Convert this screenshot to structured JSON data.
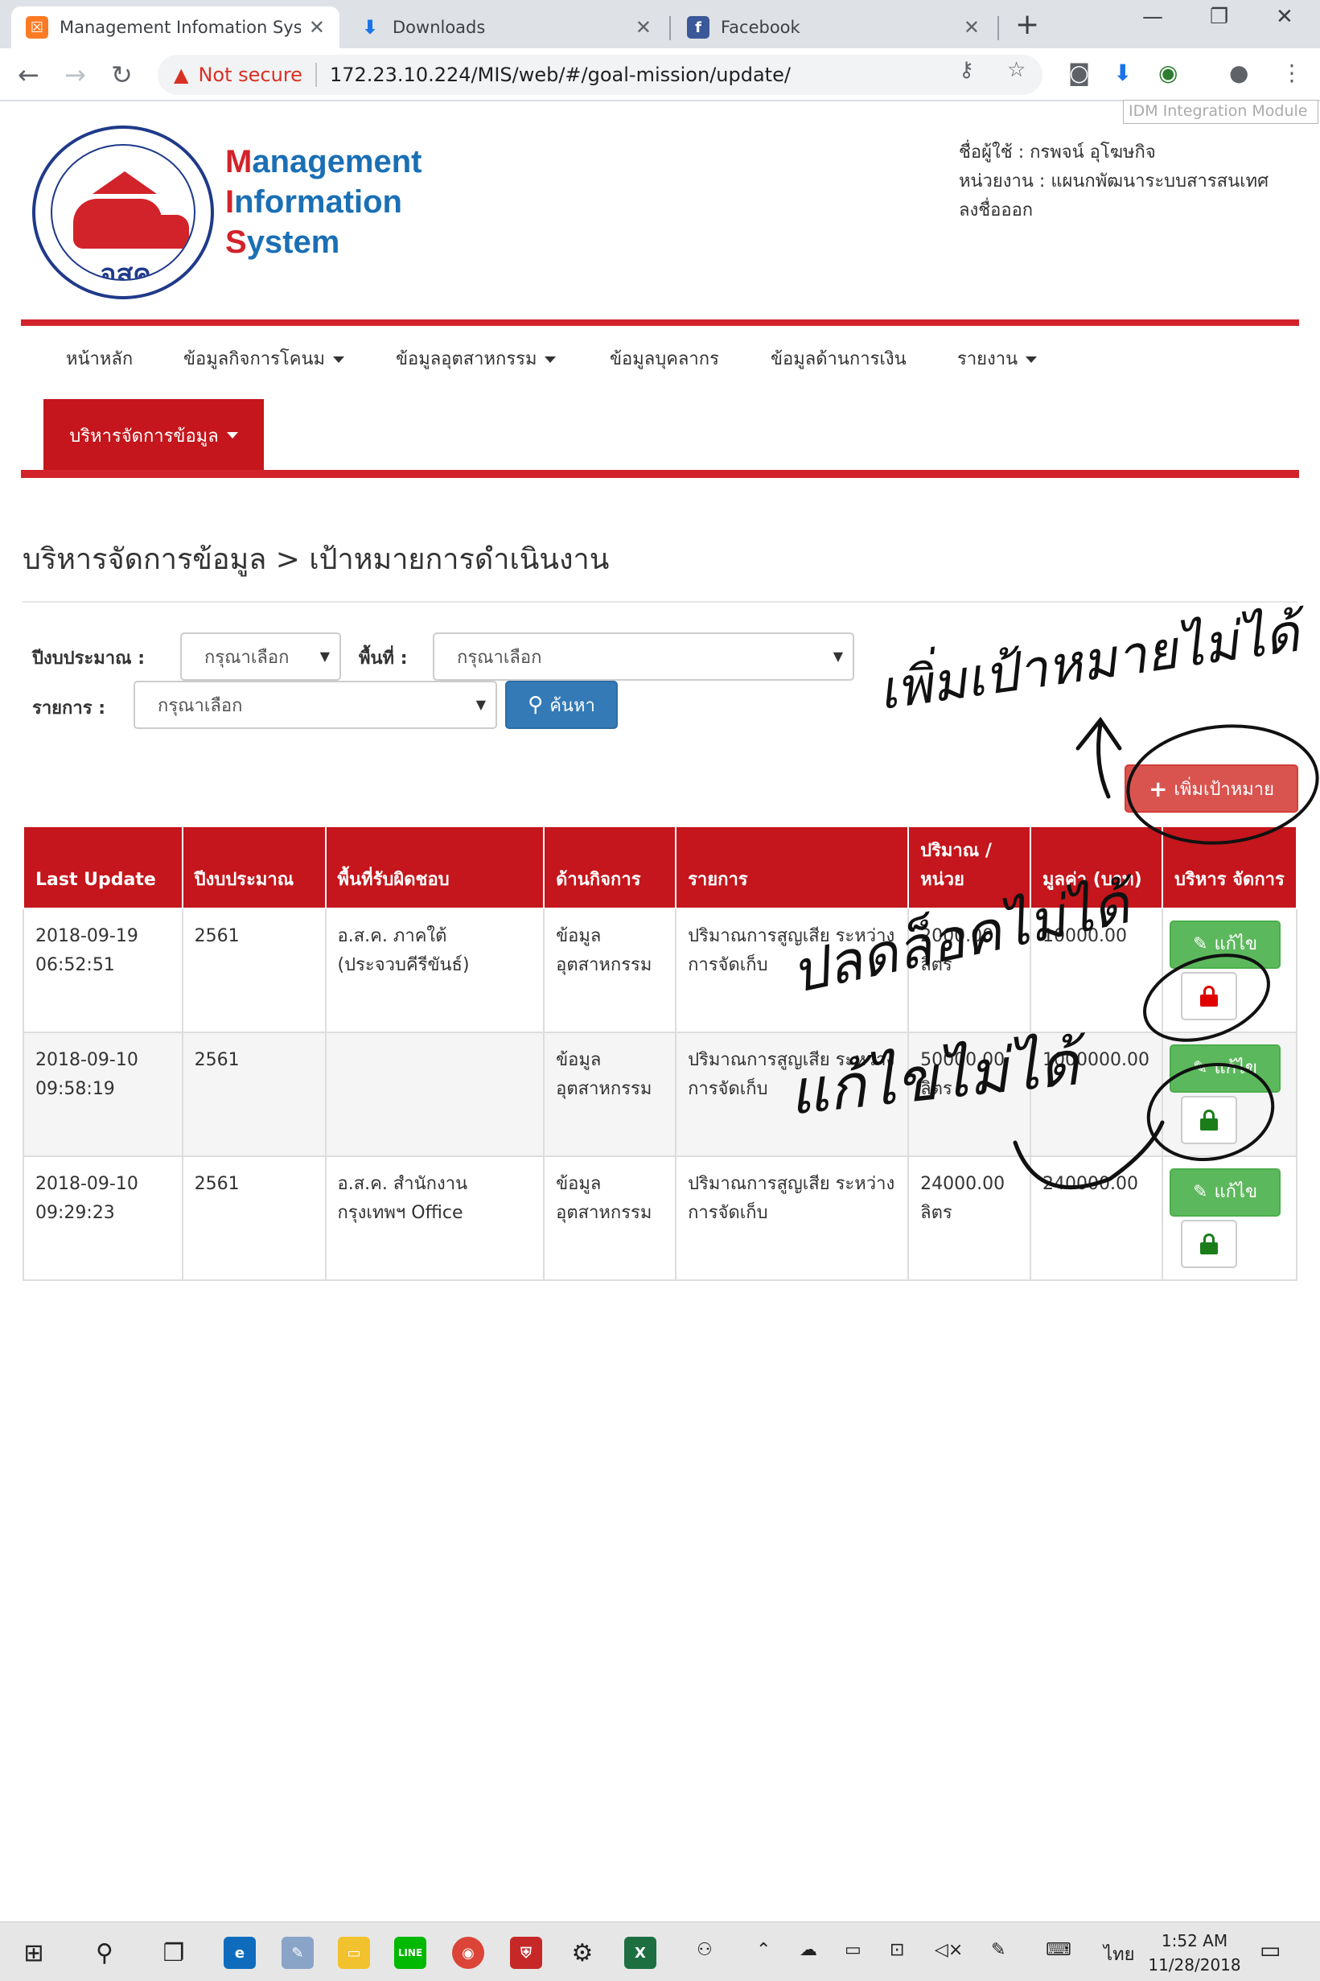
{
  "browser": {
    "tabs": [
      {
        "title": "Management Infomation Syste",
        "favicon": "xampp-icon"
      },
      {
        "title": "Downloads",
        "favicon": "download-icon"
      },
      {
        "title": "Facebook",
        "favicon": "facebook-icon"
      }
    ],
    "security_label": "Not secure",
    "url": "172.23.10.224/MIS/web/#/goal-mission/update/",
    "idm_tooltip": "IDM Integration Module"
  },
  "header": {
    "logo_text": "อสค",
    "title_lines": [
      {
        "cap": "M",
        "rest": "anagement"
      },
      {
        "cap": "I",
        "rest": "nformation"
      },
      {
        "cap": "S",
        "rest": "ystem"
      }
    ],
    "user_label": "ชื่อผู้ใช้ : กรพจน์ อุโฆษกิจ",
    "unit_label": "หน่วยงาน : แผนกพัฒนาระบบสารสนเทศ",
    "logout_label": "ลงชื่อออก"
  },
  "nav": {
    "items": [
      "หน้าหลัก",
      "ข้อมูลกิจการโคนม",
      "ข้อมูลอุตสาหกรรม",
      "ข้อมูลบุคลากร",
      "ข้อมูลด้านการเงิน",
      "รายงาน"
    ],
    "active": "บริหารจัดการข้อมูล"
  },
  "page": {
    "title": "บริหารจัดการข้อมูล > เป้าหมายการดำเนินงาน"
  },
  "filters": {
    "year_label": "ปีงบประมาณ :",
    "year_value": "กรุณาเลือก",
    "area_label": "พื้นที่ :",
    "area_value": "กรุณาเลือก",
    "item_label": "รายการ :",
    "item_value": "กรุณาเลือก",
    "search_label": "ค้นหา",
    "add_label": "เพิ่มเป้าหมาย"
  },
  "table": {
    "headers": [
      "Last Update",
      "ปีงบประมาณ",
      "พื้นที่รับผิดชอบ",
      "ด้านกิจการ",
      "รายการ",
      "ปริมาณ / หน่วย",
      "มูลค่า (บาท)",
      "บริหาร จัดการ"
    ],
    "edit_label": "แก้ไข",
    "rows": [
      {
        "updated": "2018-09-19 06:52:51",
        "year": "2561",
        "area": "อ.ส.ค. ภาคใต้ (ประจวบคีรีขันธ์)",
        "category": "ข้อมูล อุตสาหกรรม",
        "item": "ปริมาณการสูญเสีย ระหว่างการจัดเก็บ",
        "quantity": "2000.00 ลิตร",
        "value": "10000.00",
        "lock_color": "#e00000"
      },
      {
        "updated": "2018-09-10 09:58:19",
        "year": "2561",
        "area": "",
        "category": "ข้อมูล อุตสาหกรรม",
        "item": "ปริมาณการสูญเสีย ระหว่างการจัดเก็บ",
        "quantity": "50000.00 ลิตร",
        "value": "1000000.00",
        "lock_color": "#1a7d1a"
      },
      {
        "updated": "2018-09-10 09:29:23",
        "year": "2561",
        "area": "อ.ส.ค. สำนักงาน กรุงเทพฯ Office",
        "category": "ข้อมูล อุตสาหกรรม",
        "item": "ปริมาณการสูญเสีย ระหว่างการจัดเก็บ",
        "quantity": "24000.00 ลิตร",
        "value": "240000.00",
        "lock_color": "#1a7d1a"
      }
    ]
  },
  "annotations": {
    "note_add": "เพิ่มเป้าหมายไม่ได้",
    "note_unlock": "ปลดล็อคไม่ได้",
    "note_edit": "แก้ไขไม่ได้"
  },
  "taskbar": {
    "language": "ไทย",
    "time": "1:52 AM",
    "date": "11/28/2018"
  }
}
